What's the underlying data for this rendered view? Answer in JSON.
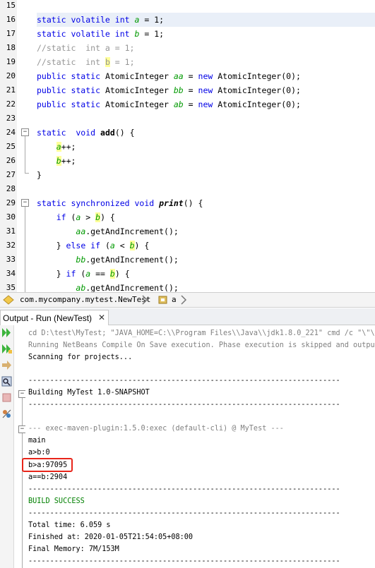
{
  "editor": {
    "lines": [
      {
        "num": "15",
        "text": ""
      },
      {
        "num": "16",
        "text": "static volatile int a = 1;"
      },
      {
        "num": "17",
        "text": "static volatile int b = 1;"
      },
      {
        "num": "18",
        "text": "//static  int a = 1;"
      },
      {
        "num": "19",
        "text": "//static  int b = 1;"
      },
      {
        "num": "20",
        "text": "public static AtomicInteger aa = new AtomicInteger(0);"
      },
      {
        "num": "21",
        "text": "public static AtomicInteger bb = new AtomicInteger(0);"
      },
      {
        "num": "22",
        "text": "public static AtomicInteger ab = new AtomicInteger(0);"
      },
      {
        "num": "23",
        "text": ""
      },
      {
        "num": "24",
        "text": "static  void add() {"
      },
      {
        "num": "25",
        "text": "a++;"
      },
      {
        "num": "26",
        "text": "b++;"
      },
      {
        "num": "27",
        "text": "}"
      },
      {
        "num": "28",
        "text": ""
      },
      {
        "num": "29",
        "text": "static synchronized void print() {"
      },
      {
        "num": "30",
        "text": "if (a > b) {"
      },
      {
        "num": "31",
        "text": "aa.getAndIncrement();"
      },
      {
        "num": "32",
        "text": "} else if (a < b) {"
      },
      {
        "num": "33",
        "text": "bb.getAndIncrement();"
      },
      {
        "num": "34",
        "text": "} if (a == b) {"
      },
      {
        "num": "35",
        "text": "ab.getAndIncrement();"
      }
    ]
  },
  "breadcrumb": {
    "items": [
      "com.mycompany.mytest.NewTest",
      "a"
    ]
  },
  "output_panel": {
    "tab_title": "Output - Run (NewTest)",
    "close_symbol": "✕",
    "lines": [
      "cd D:\\test\\MyTest; \"JAVA_HOME=C:\\\\Program Files\\\\Java\\\\jdk1.8.0_221\" cmd /c \"\\\"\\\"C",
      "Running NetBeans Compile On Save execution. Phase execution is skipped and output",
      "Scanning for projects...",
      "",
      "------------------------------------------------------------------------",
      "Building MyTest 1.0-SNAPSHOT",
      "------------------------------------------------------------------------",
      "",
      "--- exec-maven-plugin:1.5.0:exec (default-cli) @ MyTest ---",
      "main",
      "a>b:0",
      "b>a:97095",
      "a==b:2904",
      "------------------------------------------------------------------------",
      "BUILD SUCCESS",
      "------------------------------------------------------------------------",
      "Total time: 6.059 s",
      "Finished at: 2020-01-05T21:54:05+08:00",
      "Final Memory: 7M/153M",
      "------------------------------------------------------------------------"
    ]
  },
  "toolbar": {
    "icons": [
      "rerun-icon",
      "rerun-with-options-icon",
      "stop-icon",
      "settings-icon",
      "clear-icon",
      "wrap-icon"
    ]
  },
  "colors": {
    "keyword": "#0000e6",
    "comment": "#969696",
    "field": "#009900",
    "build_success": "#008000",
    "highlight_box": "#e8251a",
    "current_line": "#e9eff8"
  }
}
